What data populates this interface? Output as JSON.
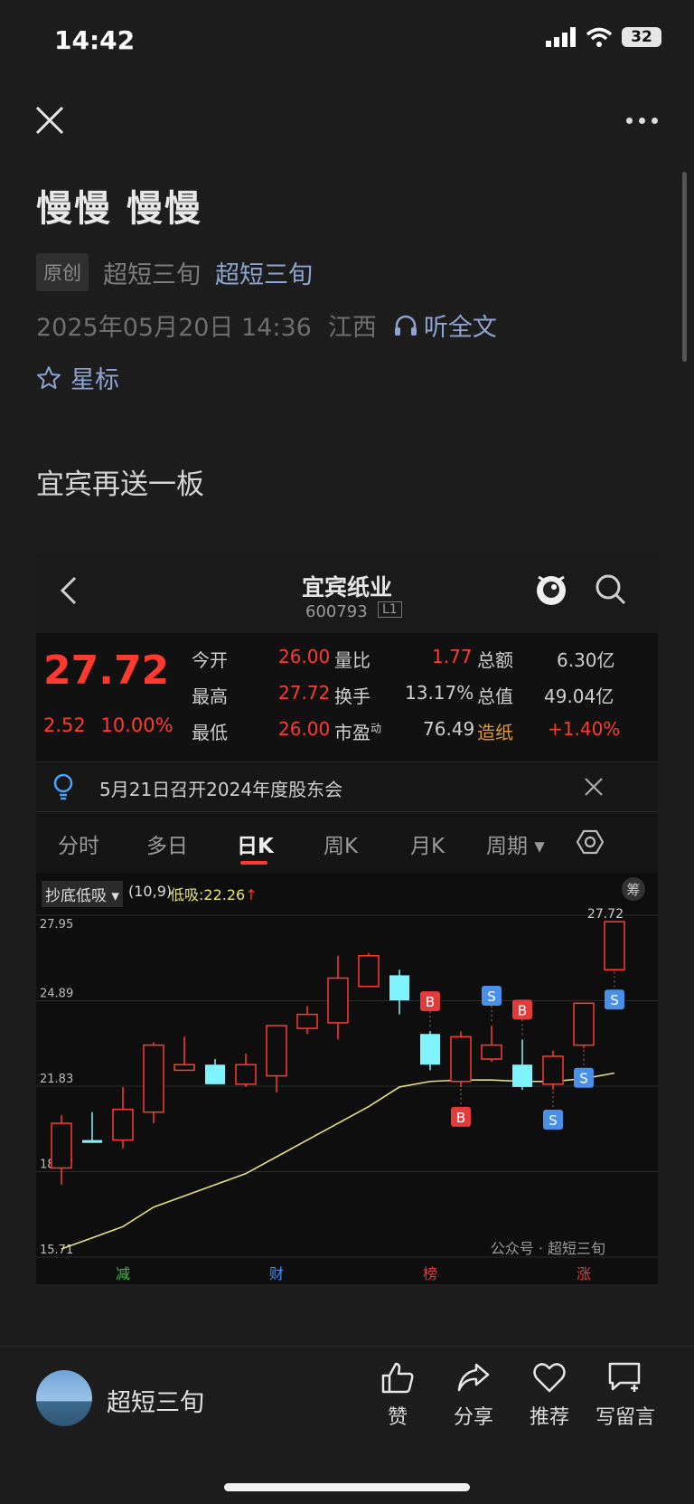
{
  "status_bar": {
    "time": "14:42",
    "battery": "32"
  },
  "article": {
    "title": "慢慢 慢慢",
    "badge": "原创",
    "author_plain": "超短三旬",
    "author_link": "超短三旬",
    "date": "2025年05月20日 14:36",
    "location": "江西",
    "listen_label": "听全文",
    "star_label": "星标",
    "body": "宜宾再送一板"
  },
  "stock": {
    "name": "宜宾纸业",
    "code": "600793",
    "level": "L1",
    "price": "27.72",
    "change": "2.52",
    "change_pct": "10.00%",
    "quote": [
      {
        "label": "今开",
        "value": "26.00"
      },
      {
        "label": "量比",
        "value": "1.77"
      },
      {
        "label": "总额",
        "value": "6.30亿"
      },
      {
        "label": "最高",
        "value": "27.72"
      },
      {
        "label": "换手",
        "value": "13.17%"
      },
      {
        "label": "总值",
        "value": "49.04亿"
      },
      {
        "label": "最低",
        "value": "26.00"
      },
      {
        "label": "市盈",
        "value": "76.49"
      },
      {
        "label": "造纸",
        "value": "+1.40%"
      }
    ],
    "pe_sup": "动",
    "notice": "5月21日召开2024年度股东会",
    "tabs": [
      "分时",
      "多日",
      "日K",
      "周K",
      "月K",
      "周期"
    ],
    "indicator": {
      "name": "抄底低吸",
      "params": "(10,9)",
      "value_text": "低吸:22.26",
      "side_badge": "筹"
    },
    "watermark": "公众号 · 超短三旬",
    "marks": [
      "减",
      "财",
      "榜",
      "涨"
    ],
    "colors": {
      "up": "#ff3b30",
      "down": "#7ff4ff",
      "ma": "#e6e08a",
      "buy": "#e23b3b",
      "sell": "#4a8fe8"
    }
  },
  "chart_data": {
    "type": "candlestick",
    "y_ticks": [
      "27.95",
      "24.89",
      "21.83",
      "18.77",
      "15.71"
    ],
    "ylim": [
      15.71,
      27.95
    ],
    "max_label": "27.72",
    "candles": [
      {
        "o": 18.9,
        "c": 20.5,
        "h": 20.8,
        "l": 18.3,
        "up": true
      },
      {
        "o": 19.9,
        "c": 19.8,
        "h": 20.9,
        "l": 19.8,
        "up": false
      },
      {
        "o": 19.9,
        "c": 21.0,
        "h": 21.8,
        "l": 19.6,
        "up": true
      },
      {
        "o": 20.9,
        "c": 23.3,
        "h": 23.4,
        "l": 20.5,
        "up": true
      },
      {
        "o": 22.4,
        "c": 22.6,
        "h": 23.6,
        "l": 22.4,
        "up": true
      },
      {
        "o": 22.6,
        "c": 21.9,
        "h": 22.8,
        "l": 21.9,
        "up": false
      },
      {
        "o": 21.9,
        "c": 22.6,
        "h": 23.0,
        "l": 21.8,
        "up": true
      },
      {
        "o": 22.2,
        "c": 24.0,
        "h": 24.0,
        "l": 21.6,
        "up": true
      },
      {
        "o": 23.9,
        "c": 24.4,
        "h": 24.7,
        "l": 23.7,
        "up": true
      },
      {
        "o": 24.1,
        "c": 25.7,
        "h": 26.5,
        "l": 23.5,
        "up": true
      },
      {
        "o": 25.4,
        "c": 26.5,
        "h": 26.6,
        "l": 25.4,
        "up": true
      },
      {
        "o": 25.8,
        "c": 24.9,
        "h": 26.0,
        "l": 24.4,
        "up": false
      },
      {
        "o": 23.7,
        "c": 22.6,
        "h": 23.8,
        "l": 22.4,
        "up": false
      },
      {
        "o": 22.0,
        "c": 23.6,
        "h": 23.8,
        "l": 21.8,
        "up": true
      },
      {
        "o": 22.8,
        "c": 23.3,
        "h": 24.0,
        "l": 22.7,
        "up": true
      },
      {
        "o": 22.6,
        "c": 21.8,
        "h": 23.5,
        "l": 21.7,
        "up": false
      },
      {
        "o": 21.9,
        "c": 22.9,
        "h": 23.1,
        "l": 21.7,
        "up": true
      },
      {
        "o": 23.3,
        "c": 24.8,
        "h": 24.8,
        "l": 23.2,
        "up": true
      },
      {
        "o": 26.0,
        "c": 27.72,
        "h": 27.72,
        "l": 26.0,
        "up": true
      }
    ],
    "ma": [
      16.0,
      16.4,
      16.8,
      17.5,
      17.9,
      18.3,
      18.7,
      19.3,
      19.9,
      20.5,
      21.1,
      21.8,
      22.0,
      22.05,
      22.05,
      22.0,
      22.0,
      22.1,
      22.3
    ],
    "signals": [
      {
        "i": 12,
        "label": "B",
        "pos": "above"
      },
      {
        "i": 13,
        "label": "B",
        "pos": "below"
      },
      {
        "i": 14,
        "label": "S",
        "pos": "above"
      },
      {
        "i": 15,
        "label": "B",
        "pos": "above"
      },
      {
        "i": 16,
        "label": "S",
        "pos": "below"
      },
      {
        "i": 17,
        "label": "S",
        "pos": "below"
      },
      {
        "i": 18,
        "label": "S",
        "pos": "below"
      }
    ]
  },
  "bottom_bar": {
    "account_name": "超短三旬",
    "actions": [
      "赞",
      "分享",
      "推荐",
      "写留言"
    ]
  }
}
